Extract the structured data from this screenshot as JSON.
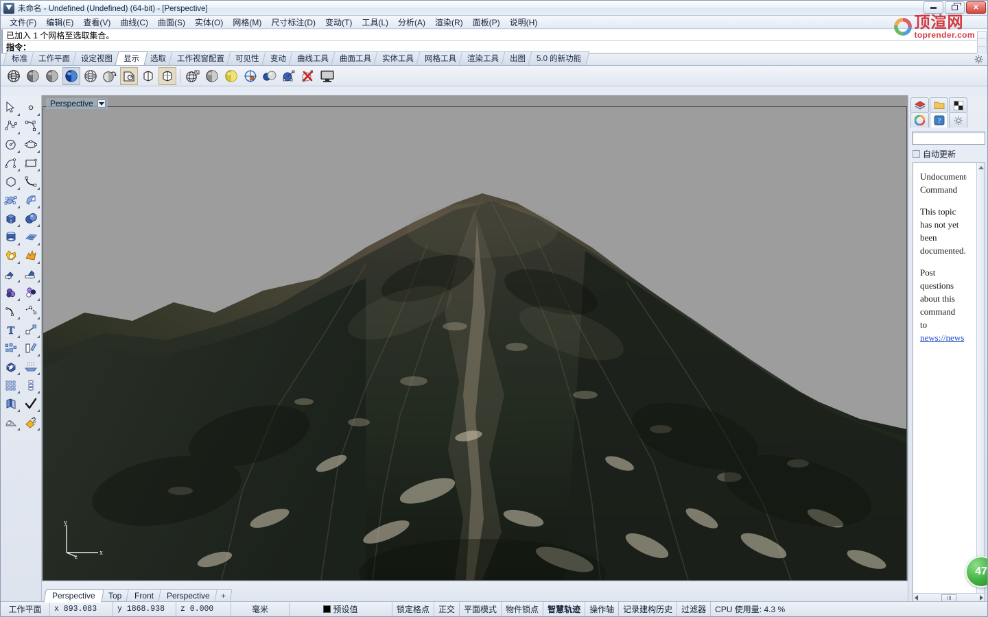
{
  "window": {
    "title": "未命名 - Undefined (Undefined) (64-bit) - [Perspective]",
    "minimize_label": "最小化",
    "maximize_label": "还原",
    "close_label": "✕"
  },
  "watermark": {
    "cn": "顶渲网",
    "en": "toprender.com"
  },
  "menu": [
    {
      "label": "文件(F)",
      "name": "menu-file"
    },
    {
      "label": "编辑(E)",
      "name": "menu-edit"
    },
    {
      "label": "查看(V)",
      "name": "menu-view"
    },
    {
      "label": "曲线(C)",
      "name": "menu-curve"
    },
    {
      "label": "曲面(S)",
      "name": "menu-surface"
    },
    {
      "label": "实体(O)",
      "name": "menu-solid"
    },
    {
      "label": "网格(M)",
      "name": "menu-mesh"
    },
    {
      "label": "尺寸标注(D)",
      "name": "menu-dimension"
    },
    {
      "label": "变动(T)",
      "name": "menu-transform"
    },
    {
      "label": "工具(L)",
      "name": "menu-tools"
    },
    {
      "label": "分析(A)",
      "name": "menu-analyze"
    },
    {
      "label": "渲染(R)",
      "name": "menu-render"
    },
    {
      "label": "面板(P)",
      "name": "menu-panels"
    },
    {
      "label": "说明(H)",
      "name": "menu-help"
    }
  ],
  "command": {
    "history": "已加入 1 个网格至选取集合。",
    "prompt": "指令："
  },
  "toolbar_tabs": [
    {
      "label": "标准",
      "active": false
    },
    {
      "label": "工作平面",
      "active": false
    },
    {
      "label": "设定视图",
      "active": false
    },
    {
      "label": "显示",
      "active": true
    },
    {
      "label": "选取",
      "active": false
    },
    {
      "label": "工作视窗配置",
      "active": false
    },
    {
      "label": "可见性",
      "active": false
    },
    {
      "label": "变动",
      "active": false
    },
    {
      "label": "曲线工具",
      "active": false
    },
    {
      "label": "曲面工具",
      "active": false
    },
    {
      "label": "实体工具",
      "active": false
    },
    {
      "label": "网格工具",
      "active": false
    },
    {
      "label": "渲染工具",
      "active": false
    },
    {
      "label": "出图",
      "active": false
    },
    {
      "label": "5.0 的新功能",
      "active": false
    }
  ],
  "display_toolbar": [
    {
      "name": "wireframe-icon",
      "state": "normal"
    },
    {
      "name": "shaded-icon",
      "state": "normal"
    },
    {
      "name": "shaded-gray-icon",
      "state": "normal"
    },
    {
      "name": "rendered-icon",
      "state": "selected"
    },
    {
      "name": "ghosted-icon",
      "state": "normal"
    },
    {
      "name": "xray-icon",
      "state": "normal"
    },
    {
      "name": "technical-icon",
      "state": "checked"
    },
    {
      "name": "artistic-icon",
      "state": "normal"
    },
    {
      "name": "pen-icon",
      "state": "checked"
    },
    {
      "name": "separator",
      "state": "sep"
    },
    {
      "name": "render-mesh-icon",
      "state": "normal"
    },
    {
      "name": "shade-icon",
      "state": "normal"
    },
    {
      "name": "light-icon",
      "state": "normal"
    },
    {
      "name": "target-icon",
      "state": "normal"
    },
    {
      "name": "color-spheres-icon",
      "state": "normal"
    },
    {
      "name": "edit-sphere-icon",
      "state": "normal"
    },
    {
      "name": "delete-render-icon",
      "state": "normal"
    },
    {
      "name": "display-monitor-icon",
      "state": "normal"
    }
  ],
  "left_tools": [
    "select-arrow-icon",
    "point-icon",
    "polyline-icon",
    "curve-control-points-icon",
    "circle-icon",
    "ellipse-icon",
    "arc-icon",
    "rectangle-icon",
    "polygon-icon",
    "freeform-curve-icon",
    "surface-control-points-icon",
    "surface-sweep-icon",
    "box-icon",
    "sphere-solid-icon",
    "cylinder-icon",
    "mesh-plane-icon",
    "boolean-union-icon",
    "explode-icon",
    "trim-icon",
    "split-icon",
    "fillet-icon",
    "chamfer-circles-icon",
    "offset-curve-icon",
    "blend-curve-icon",
    "text-icon",
    "scale-icon",
    "array-icon",
    "extrude-icon",
    "cap-icon",
    "project-icon",
    "grid-array-icon",
    "symmetry-icon",
    "copy-icon",
    "check-mark-icon",
    "shade-object-icon",
    "paint-bucket-icon"
  ],
  "viewport": {
    "label": "Perspective",
    "axis": {
      "x": "x",
      "y": "y",
      "z": "z"
    },
    "tabs": [
      {
        "label": "Perspective",
        "active": true
      },
      {
        "label": "Top",
        "active": false
      },
      {
        "label": "Front",
        "active": false
      },
      {
        "label": "Perspective",
        "active": false
      },
      {
        "label": "+",
        "active": false,
        "plus": true
      }
    ]
  },
  "right_panel": {
    "tabs_row1": [
      "layers-icon",
      "folder-icon",
      "checker-icon"
    ],
    "tabs_row2": [
      "color-wheel-icon",
      "help-question-icon",
      "gear-icon"
    ],
    "search_value": "",
    "search_placeholder": "",
    "auto_update_label": "自动更新",
    "auto_update_checked": false,
    "help": {
      "title": "Undocumented Command",
      "paragraph1": "This topic has not yet been documented.",
      "paragraph2_pre": "Post questions about this command to",
      "link": "news://news"
    },
    "badge": "47"
  },
  "statusbar": {
    "cplane_label": "工作平面",
    "x": "x  893.083",
    "y": "y  1868.938",
    "z": "z  0.000",
    "units": "毫米",
    "layer": "预设值",
    "layer_color": "#000000",
    "toggles": [
      {
        "label": "锁定格点",
        "on": false
      },
      {
        "label": "正交",
        "on": false
      },
      {
        "label": "平面模式",
        "on": false
      },
      {
        "label": "物件锁点",
        "on": false
      },
      {
        "label": "智慧轨迹",
        "on": true
      },
      {
        "label": "操作轴",
        "on": false
      },
      {
        "label": "记录建构历史",
        "on": false
      },
      {
        "label": "过滤器",
        "on": false
      }
    ],
    "cpu": "CPU 使用量: 4.3 %"
  }
}
